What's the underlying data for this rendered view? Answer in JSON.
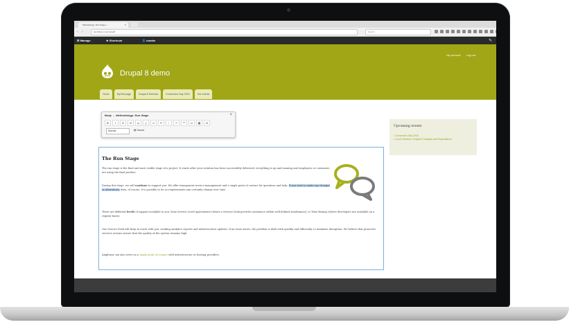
{
  "browser": {
    "tab_title": "Methodology: Run Stage | ...",
    "tab_close": "×",
    "url": "dev.8demo.com/node/8",
    "search_placeholder": "Search",
    "nav_back": "‹",
    "nav_forward": "›"
  },
  "admin_toolbar": {
    "manage": "Manage",
    "shortcuts": "Shortcuts",
    "user": "numbe",
    "pencil": "✎"
  },
  "header": {
    "site_name": "Drupal 8 demo",
    "my_account": "My account",
    "log_out": "Log out",
    "nav_tabs": [
      "Home",
      "My first page",
      "Drupal 8 Seminar",
      "Conversion Day 2015",
      "Our events"
    ]
  },
  "editor": {
    "title": "Body ↔ Methodology: Run Stage",
    "close": "×",
    "buttons": [
      "B",
      "I",
      "S",
      "x²",
      "x₂",
      "I̲",
      "∞",
      "✂",
      "⋮",
      "≡",
      "❝",
      "▭",
      "▦",
      "Ω"
    ],
    "format_value": "Normal",
    "source_label": "Source"
  },
  "article": {
    "title": "The Run Stage",
    "p1": "The run stage is the final and most visible stage of a project. It starts after your solution has been successfully delivered: everything is up and running and employees or customers are using the final product.",
    "p2_before": "During this stage, we will ",
    "p2_bold": "continue",
    "p2_middle": " to support you. We offer transparent service management and a single point of contact for questions and help. ",
    "p2_highlight": "If you wish to make any changes or alterations,",
    "p2_after": " then, of course, it is possible to do so requirements any certainly change over time.",
    "p3_before": "There are different ",
    "p3_bold": "levels",
    "p3_after": " of support available to you, from Service Level Agreements (where a Service Desk provides assistance within well-defined timeframes), to Time Boxing (where developers are available on a regular basis).",
    "p4": "Our Service Desk will keep in touch with you, sending analytics reports and infrastructure updates. If an issue arises, the problem is dealt with quickly and efficiently, to minimize disruption. We believe that proactive services actions ensure that the quality of the system remains high.",
    "p5_before": "Amplexor can also serve as a ",
    "p5_link": "single point of contact",
    "p5_after": " with infrastructure or hosting providers."
  },
  "sidebar": {
    "title": "Upcoming events",
    "events": [
      "Conversion Day 2016",
      "Lunch Session: Drupal 8 Concepts and Expectations"
    ]
  },
  "colors": {
    "brand": "#a0a616",
    "link": "#9aa31b",
    "bubble_green": "#a9b01a",
    "bubble_grey": "#7a7a7a"
  }
}
